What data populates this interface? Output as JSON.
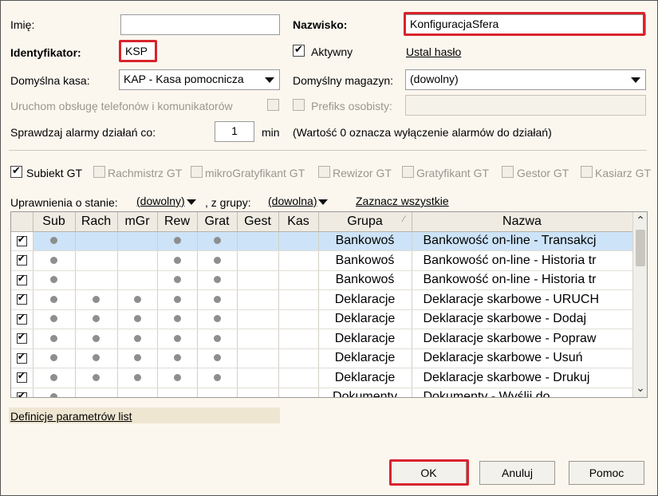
{
  "form": {
    "imie_label": "Imię:",
    "imie_value": "",
    "nazwisko_label": "Nazwisko:",
    "nazwisko_value": "KonfiguracjaSfera",
    "identyfikator_label": "Identyfikator:",
    "identyfikator_value": "KSP",
    "aktywny_label": "Aktywny",
    "ustal_haslo": "Ustal hasło",
    "domyslna_kasa_label": "Domyślna kasa:",
    "domyslna_kasa_value": "KAP - Kasa pomocnicza",
    "domyslny_magazyn_label": "Domyślny magazyn:",
    "domyslny_magazyn_value": "(dowolny)",
    "uruchom_label": "Uruchom obsługę telefonów i komunikatorów",
    "prefiks_label": "Prefiks osobisty:",
    "prefiks_value": "",
    "sprawdzaj_label": "Sprawdzaj alarmy działań co:",
    "sprawdzaj_value": "1",
    "min_label": "min",
    "info_note": "(Wartość 0 oznacza wyłączenie alarmów do działań)"
  },
  "modules": [
    {
      "label": "Subiekt GT",
      "checked": true,
      "enabled": true
    },
    {
      "label": "Rachmistrz GT",
      "checked": false,
      "enabled": false
    },
    {
      "label": "mikroGratyfikant GT",
      "checked": false,
      "enabled": false
    },
    {
      "label": "Rewizor GT",
      "checked": false,
      "enabled": false
    },
    {
      "label": "Gratyfikant GT",
      "checked": false,
      "enabled": false
    },
    {
      "label": "Gestor GT",
      "checked": false,
      "enabled": false
    },
    {
      "label": "Kasiarz GT",
      "checked": false,
      "enabled": false
    }
  ],
  "permissions": {
    "stan_label": "Uprawnienia o stanie:",
    "stan_value": "(dowolny)",
    "grupa_label": ", z grupy:",
    "grupa_value": "(dowolna)",
    "zaznacz": "Zaznacz wszystkie"
  },
  "table": {
    "columns": [
      "Sub",
      "Rach",
      "mGr",
      "Rew",
      "Grat",
      "Gest",
      "Kas",
      "Grupa",
      "Nazwa"
    ],
    "rows": [
      {
        "checked": true,
        "dots": [
          1,
          0,
          0,
          1,
          1,
          0,
          0
        ],
        "grupa": "Bankowoś",
        "nazwa": "Bankowość on-line - Transakcj",
        "selected": true
      },
      {
        "checked": true,
        "dots": [
          1,
          0,
          0,
          1,
          1,
          0,
          0
        ],
        "grupa": "Bankowoś",
        "nazwa": "Bankowość on-line - Historia tr",
        "selected": false
      },
      {
        "checked": true,
        "dots": [
          1,
          0,
          0,
          1,
          1,
          0,
          0
        ],
        "grupa": "Bankowoś",
        "nazwa": "Bankowość on-line - Historia tr",
        "selected": false
      },
      {
        "checked": true,
        "dots": [
          1,
          1,
          1,
          1,
          1,
          0,
          0
        ],
        "grupa": "Deklaracje",
        "nazwa": "Deklaracje skarbowe - URUCH",
        "selected": false
      },
      {
        "checked": true,
        "dots": [
          1,
          1,
          1,
          1,
          1,
          0,
          0
        ],
        "grupa": "Deklaracje",
        "nazwa": "Deklaracje skarbowe - Dodaj",
        "selected": false
      },
      {
        "checked": true,
        "dots": [
          1,
          1,
          1,
          1,
          1,
          0,
          0
        ],
        "grupa": "Deklaracje",
        "nazwa": "Deklaracje skarbowe - Popraw",
        "selected": false
      },
      {
        "checked": true,
        "dots": [
          1,
          1,
          1,
          1,
          1,
          0,
          0
        ],
        "grupa": "Deklaracje",
        "nazwa": "Deklaracje skarbowe - Usuń",
        "selected": false
      },
      {
        "checked": true,
        "dots": [
          1,
          1,
          1,
          1,
          1,
          0,
          0
        ],
        "grupa": "Deklaracje",
        "nazwa": "Deklaracje skarbowe - Drukuj",
        "selected": false
      },
      {
        "checked": true,
        "dots": [
          1,
          0,
          0,
          0,
          0,
          0,
          0
        ],
        "grupa": "Dokumenty",
        "nazwa": "Dokumenty - Wyślij do",
        "selected": false
      }
    ]
  },
  "footer": {
    "definicje": "Definicje parametrów list",
    "ok": "OK",
    "anuluj": "Anuluj",
    "pomoc": "Pomoc"
  },
  "colors": {
    "accent_red": "#d9232d",
    "selection": "#cde3f7",
    "dialog_bg": "#fbf7ef"
  }
}
